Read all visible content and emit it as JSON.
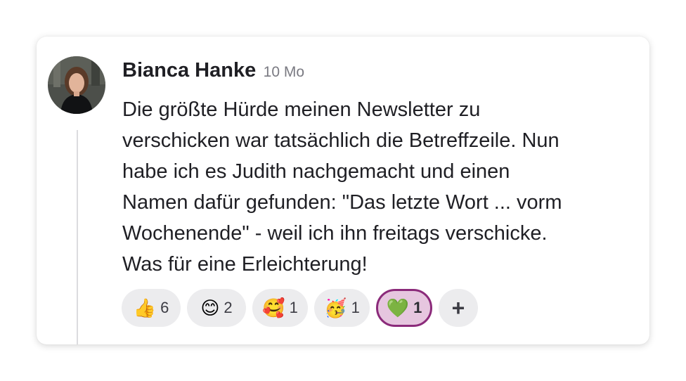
{
  "comment": {
    "author": "Bianca Hanke",
    "timestamp": "10 Mo",
    "message_lines": [
      "Die größte Hürde meinen Newsletter zu",
      "verschicken war tatsächlich die Betreffzeile. Nun",
      "habe ich es Judith nachgemacht und einen",
      "Namen dafür gefunden: \"Das letzte Wort ... vorm",
      "Wochenende\" - weil ich ihn freitags verschicke.",
      "Was für eine Erleichterung!"
    ]
  },
  "reactions": [
    {
      "emoji": "👍",
      "count": "6"
    },
    {
      "emoji": "😊",
      "count": "2"
    },
    {
      "emoji": "🥰",
      "count": "1"
    },
    {
      "emoji": "🥳",
      "count": "1"
    },
    {
      "emoji": "💚",
      "count": "1"
    }
  ],
  "add_reaction": {
    "label": "+"
  },
  "colors": {
    "active_reaction_bg": "#e6c6df",
    "active_reaction_border": "#8b2a7a",
    "reaction_bg": "#ececee",
    "text": "#1f1f24",
    "muted": "#7a7a82"
  }
}
